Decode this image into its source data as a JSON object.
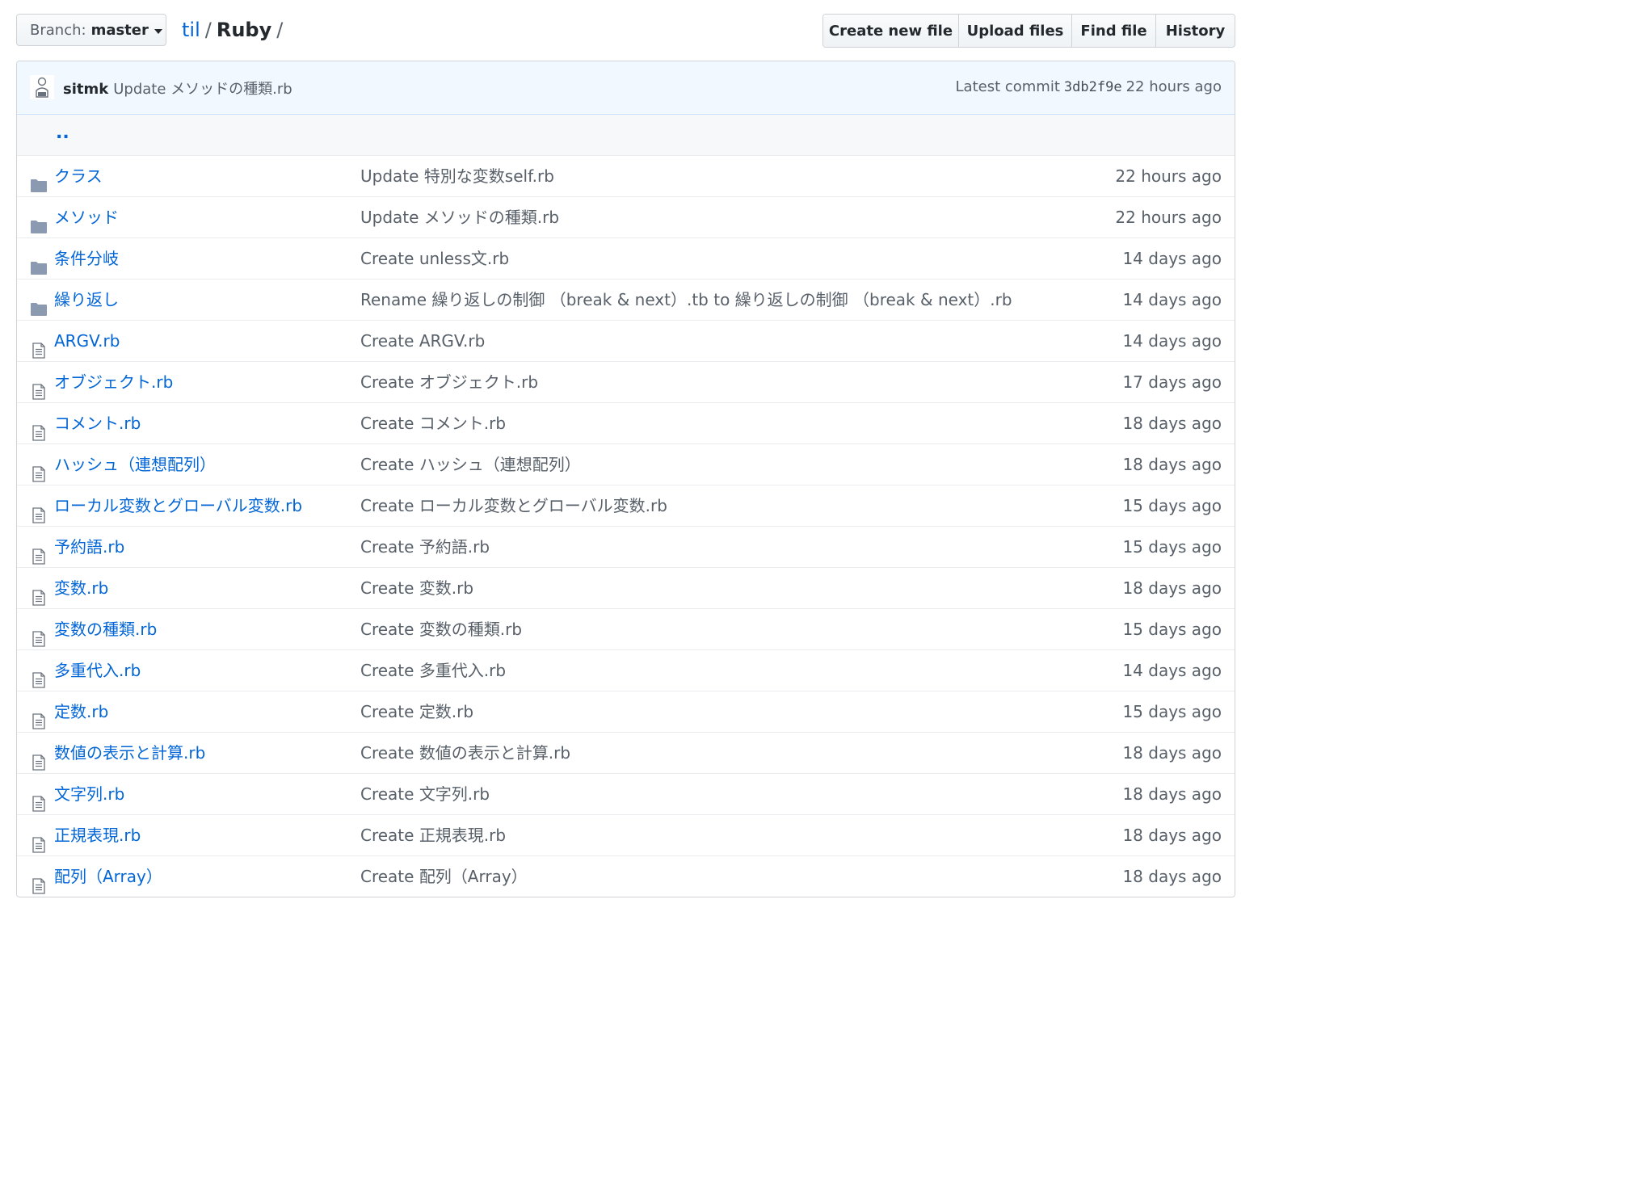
{
  "branch": {
    "label": "Branch:",
    "value": "master"
  },
  "breadcrumb": {
    "root": "til",
    "sep1": "/",
    "current": "Ruby",
    "sep2": "/"
  },
  "actions": {
    "create_new_file": "Create new file",
    "upload_files": "Upload files",
    "find_file": "Find file",
    "history": "History"
  },
  "commit": {
    "author": "sitmk",
    "message": "Update メソッドの種類.rb",
    "latest_label": "Latest commit",
    "sha": "3db2f9e",
    "age": "22 hours ago"
  },
  "parent_link": "..",
  "colors": {
    "link": "#0366d6",
    "muted": "#586069",
    "folder": "#79b8ff",
    "commit_bg": "#f1f8ff"
  },
  "files": [
    {
      "type": "folder",
      "icon": "folder-icon",
      "name": "クラス",
      "message": "Update 特別な変数self.rb",
      "age": "22 hours ago"
    },
    {
      "type": "folder",
      "icon": "folder-icon",
      "name": "メソッド",
      "message": "Update メソッドの種類.rb",
      "age": "22 hours ago"
    },
    {
      "type": "folder",
      "icon": "folder-icon",
      "name": "条件分岐",
      "message": "Create unless文.rb",
      "age": "14 days ago"
    },
    {
      "type": "folder",
      "icon": "folder-icon",
      "name": "繰り返し",
      "message": "Rename 繰り返しの制御 （break & next）.tb to 繰り返しの制御 （break & next）.rb",
      "age": "14 days ago"
    },
    {
      "type": "file",
      "icon": "file-icon",
      "name": "ARGV.rb",
      "message": "Create ARGV.rb",
      "age": "14 days ago"
    },
    {
      "type": "file",
      "icon": "file-icon",
      "name": "オブジェクト.rb",
      "message": "Create オブジェクト.rb",
      "age": "17 days ago"
    },
    {
      "type": "file",
      "icon": "file-icon",
      "name": "コメント.rb",
      "message": "Create コメント.rb",
      "age": "18 days ago"
    },
    {
      "type": "file",
      "icon": "file-icon",
      "name": "ハッシュ（連想配列）",
      "message": "Create ハッシュ（連想配列）",
      "age": "18 days ago"
    },
    {
      "type": "file",
      "icon": "file-icon",
      "name": "ローカル変数とグローバル変数.rb",
      "message": "Create ローカル変数とグローバル変数.rb",
      "age": "15 days ago"
    },
    {
      "type": "file",
      "icon": "file-icon",
      "name": "予約語.rb",
      "message": "Create 予約語.rb",
      "age": "15 days ago"
    },
    {
      "type": "file",
      "icon": "file-icon",
      "name": "変数.rb",
      "message": "Create 変数.rb",
      "age": "18 days ago"
    },
    {
      "type": "file",
      "icon": "file-icon",
      "name": "変数の種類.rb",
      "message": "Create 変数の種類.rb",
      "age": "15 days ago"
    },
    {
      "type": "file",
      "icon": "file-icon",
      "name": "多重代入.rb",
      "message": "Create 多重代入.rb",
      "age": "14 days ago"
    },
    {
      "type": "file",
      "icon": "file-icon",
      "name": "定数.rb",
      "message": "Create 定数.rb",
      "age": "15 days ago"
    },
    {
      "type": "file",
      "icon": "file-icon",
      "name": "数値の表示と計算.rb",
      "message": "Create 数値の表示と計算.rb",
      "age": "18 days ago"
    },
    {
      "type": "file",
      "icon": "file-icon",
      "name": "文字列.rb",
      "message": "Create 文字列.rb",
      "age": "18 days ago"
    },
    {
      "type": "file",
      "icon": "file-icon",
      "name": "正規表現.rb",
      "message": "Create 正規表現.rb",
      "age": "18 days ago"
    },
    {
      "type": "file",
      "icon": "file-icon",
      "name": "配列（Array）",
      "message": "Create 配列（Array）",
      "age": "18 days ago"
    }
  ]
}
